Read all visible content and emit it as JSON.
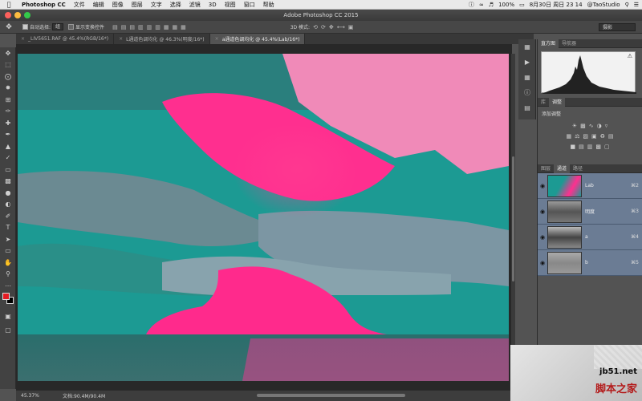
{
  "menubar": {
    "apple_icon": "apple-icon",
    "app_name": "Photoshop CC",
    "items": [
      "文件",
      "编辑",
      "图像",
      "图层",
      "文字",
      "选择",
      "滤镜",
      "3D",
      "视图",
      "窗口",
      "帮助"
    ],
    "battery": "100%",
    "datetime": "8月30日 周日  23 14",
    "user": "@TaoStudio"
  },
  "window": {
    "title": "Adobe Photoshop CC 2015"
  },
  "options": {
    "auto_select_label": "自动选择:",
    "auto_select_value": "组",
    "show_transform_label": "显示变换控件",
    "mode_3d_label": "3D 模式:",
    "workspace": "摄影"
  },
  "tabs": [
    {
      "label": "_LIV5651.RAF @ 45.4%(RGB/16*)"
    },
    {
      "label": "L通道色调均化 @ 46.3%(明度/16*)"
    },
    {
      "label": "a通道色调均化 @ 45.4%(Lab/16*)"
    }
  ],
  "status": {
    "zoom": "45.37%",
    "doc": "文档:90.4M/90.4M"
  },
  "panels": {
    "histogram_tabs": [
      "直方图",
      "导航器"
    ],
    "adjust_tabs": [
      "库",
      "调整"
    ],
    "adjust_label": "添加调整",
    "channel_tabs": [
      "图层",
      "通道",
      "路径"
    ],
    "channels": [
      {
        "name": "Lab",
        "key": "⌘2"
      },
      {
        "name": "明度",
        "key": "⌘3"
      },
      {
        "name": "a",
        "key": "⌘4"
      },
      {
        "name": "b",
        "key": "⌘5"
      }
    ]
  },
  "watermark": {
    "site": "jb51.net",
    "cn": "脚本之家"
  },
  "colors": {
    "fg": "#e41b23",
    "bg": "#000000",
    "accent_teal": "#1d9c95",
    "accent_pink": "#ff1f7d"
  }
}
